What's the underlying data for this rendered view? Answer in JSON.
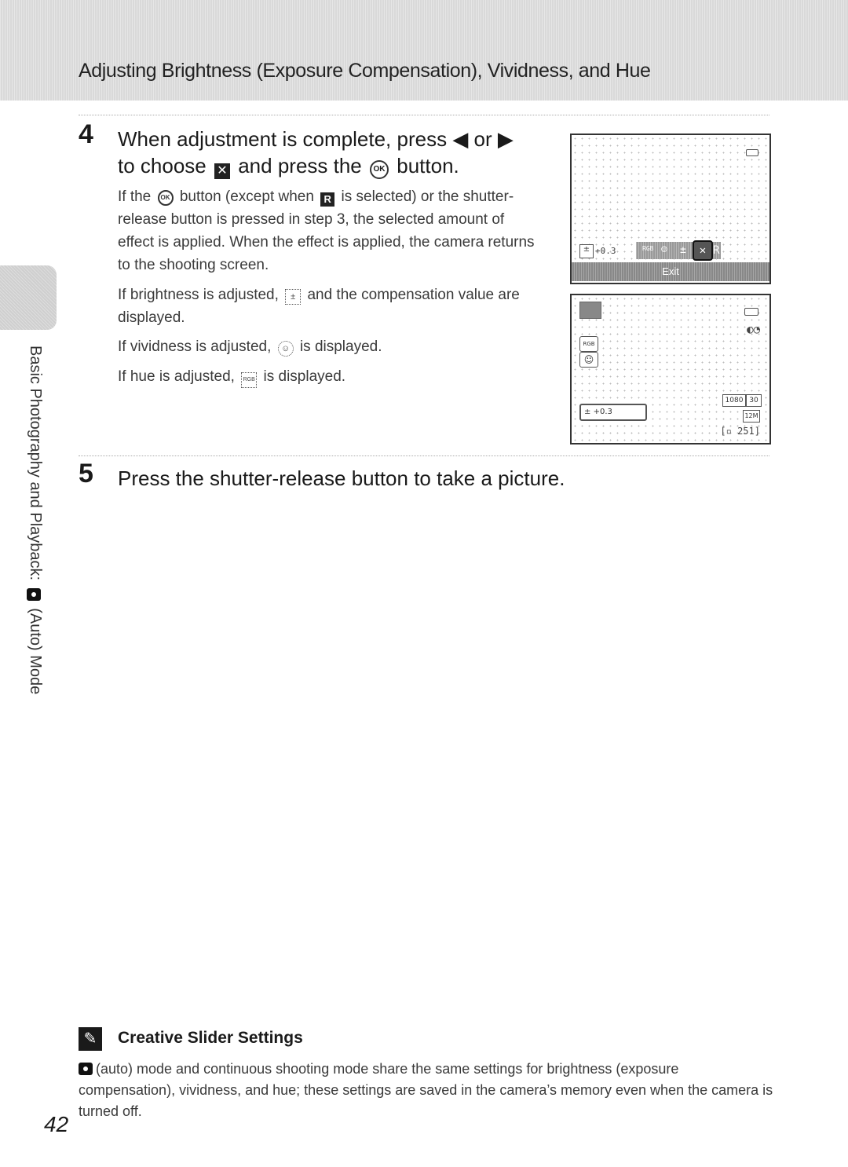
{
  "header": {
    "title": "Adjusting Brightness (Exposure Compensation), Vividness, and Hue"
  },
  "side_tab": {
    "label": "Basic Photography and Playback:",
    "icon": "camera-auto-icon",
    "suffix": "(Auto) Mode"
  },
  "step4": {
    "number": "4",
    "title_part1": "When adjustment is complete, press",
    "left_glyph": "◀",
    "or": "or",
    "right_glyph": "▶",
    "title_part2": "to choose",
    "exit_glyph": "✕",
    "title_part3": "and press the",
    "ok_glyph": "OK",
    "title_part4": "button.",
    "para1_a": "If the",
    "para1_ok": "OK",
    "para1_b": "button (except when",
    "para1_reset": "R",
    "para1_c": "is selected) or the shutter-release button is pressed in step 3, the selected amount of effect is applied. When the effect is applied, the camera returns to the shooting screen.",
    "para2_a": "If brightness is adjusted,",
    "para2_icon": "±",
    "para2_b": "and the compensation value are displayed.",
    "para3_a": "If vividness is adjusted,",
    "para3_icon": "☺",
    "para3_b": "is displayed.",
    "para4_a": "If hue is adjusted,",
    "para4_icon": "RGB",
    "para4_b": "is displayed."
  },
  "screen1": {
    "battery_icon": "battery-icon",
    "exposure_value": "+0.3",
    "slider_icons": [
      "RGB",
      "☺",
      "±",
      "✕",
      "R"
    ],
    "selected": "✕",
    "exit_label": "Exit"
  },
  "screen2": {
    "mode_icon": "auto-mode-icon",
    "battery_icon": "battery-icon",
    "vr_icon": "vibration-reduction-icon",
    "hue_icon": "RGB",
    "vividness_icon": "☺",
    "exposure_value": "+0.3",
    "movie_size": "1080",
    "movie_fps": "30",
    "image_size": "12M",
    "remaining_shots": "251"
  },
  "step5": {
    "number": "5",
    "title": "Press the shutter-release button to take a picture."
  },
  "note": {
    "title": "Creative Slider Settings",
    "body": "(auto) mode and continuous shooting mode share the same settings for brightness (exposure compensation), vividness, and hue; these settings are saved in the camera’s memory even when the camera is turned off."
  },
  "page_number": "42"
}
